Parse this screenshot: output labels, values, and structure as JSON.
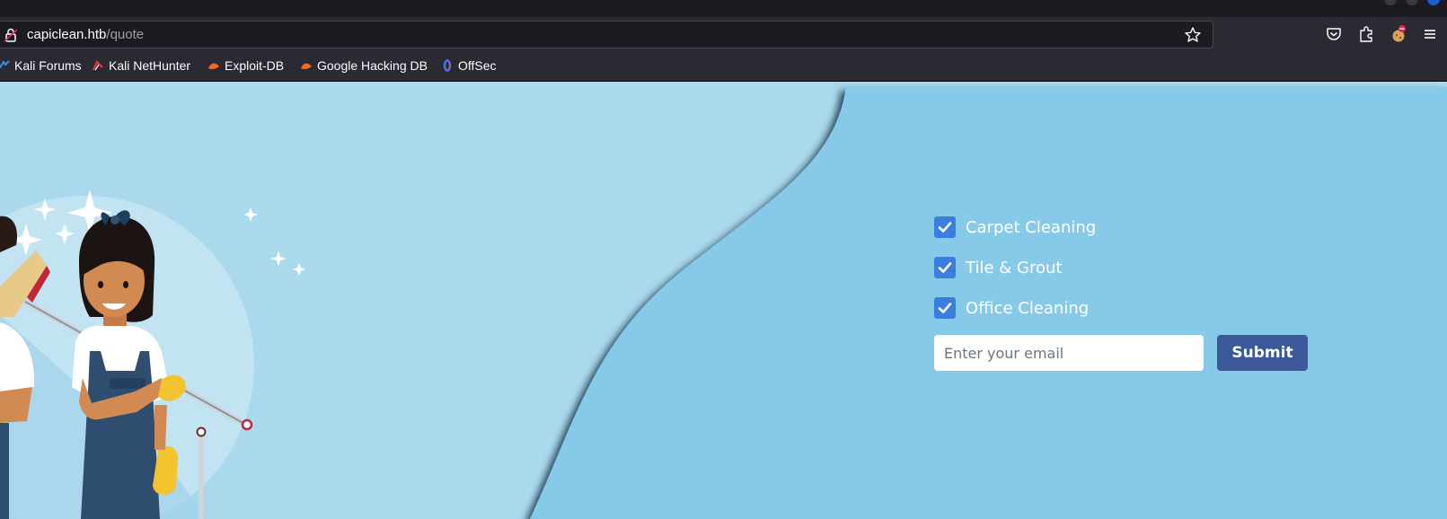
{
  "browser": {
    "url_host": "capiclean.htb",
    "url_path": "/quote",
    "bookmarks": [
      {
        "label": "Kali Forums",
        "icon": "kali-forums-icon"
      },
      {
        "label": "Kali NetHunter",
        "icon": "kali-nethunter-icon"
      },
      {
        "label": "Exploit-DB",
        "icon": "exploit-db-icon"
      },
      {
        "label": "Google Hacking DB",
        "icon": "google-hacking-db-icon"
      },
      {
        "label": "OffSec",
        "icon": "offsec-icon"
      }
    ]
  },
  "quote_form": {
    "services": [
      {
        "label": "Carpet Cleaning",
        "checked": true
      },
      {
        "label": "Tile & Grout",
        "checked": true
      },
      {
        "label": "Office Cleaning",
        "checked": true
      }
    ],
    "email_placeholder": "Enter your email",
    "submit_label": "Submit"
  },
  "colors": {
    "page_left": "#aad9ec",
    "page_right": "#87c9e9",
    "checkbox": "#3a7ee0",
    "submit_button": "#3b5998"
  }
}
